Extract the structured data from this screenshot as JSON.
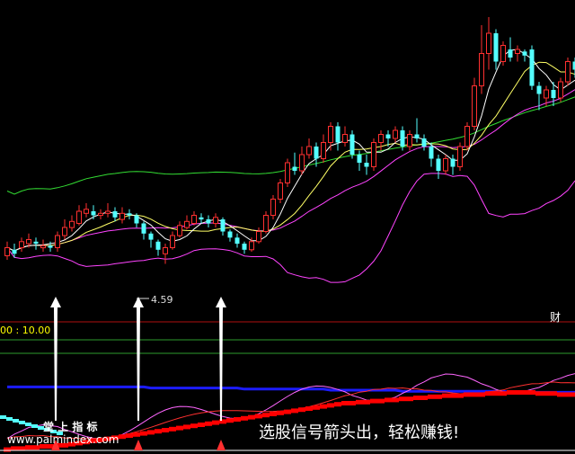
{
  "chart_data": {
    "type": "candlestick",
    "price_panel": {
      "ylim": [
        3.5,
        10.5
      ],
      "candles": [
        [
          4.4,
          4.6,
          4.75,
          4.3
        ],
        [
          4.55,
          4.45,
          4.7,
          4.35
        ],
        [
          4.6,
          4.75,
          4.85,
          4.5
        ],
        [
          4.7,
          4.8,
          4.95,
          4.6
        ],
        [
          4.75,
          4.7,
          4.85,
          4.55
        ],
        [
          4.6,
          4.65,
          4.8,
          4.5
        ],
        [
          4.65,
          4.6,
          4.75,
          4.5
        ],
        [
          4.6,
          4.9,
          5.0,
          4.5
        ],
        [
          4.9,
          5.1,
          5.3,
          4.8
        ],
        [
          5.1,
          5.25,
          5.4,
          5.0
        ],
        [
          5.2,
          5.5,
          5.65,
          5.15
        ],
        [
          5.45,
          5.55,
          5.7,
          5.35
        ],
        [
          5.5,
          5.4,
          5.65,
          5.3
        ],
        [
          5.4,
          5.45,
          5.55,
          5.3
        ],
        [
          5.45,
          5.5,
          5.7,
          5.35
        ],
        [
          5.5,
          5.35,
          5.6,
          5.25
        ],
        [
          5.3,
          5.45,
          5.6,
          5.2
        ],
        [
          5.45,
          5.4,
          5.55,
          5.3
        ],
        [
          5.4,
          5.2,
          5.45,
          5.1
        ],
        [
          5.2,
          4.95,
          5.25,
          4.8
        ],
        [
          4.95,
          4.8,
          5.0,
          4.6
        ],
        [
          4.75,
          4.55,
          4.8,
          4.4
        ],
        [
          4.45,
          4.6,
          4.7,
          4.2
        ],
        [
          4.6,
          4.9,
          5.0,
          4.55
        ],
        [
          4.9,
          5.15,
          5.25,
          4.85
        ],
        [
          5.1,
          5.25,
          5.4,
          5.05
        ],
        [
          5.2,
          5.4,
          5.5,
          5.15
        ],
        [
          5.35,
          5.3,
          5.45,
          5.2
        ],
        [
          5.3,
          5.2,
          5.4,
          5.1
        ],
        [
          5.2,
          5.35,
          5.45,
          5.1
        ],
        [
          5.3,
          5.0,
          5.35,
          4.9
        ],
        [
          5.0,
          4.85,
          5.05,
          4.75
        ],
        [
          4.85,
          4.7,
          4.95,
          4.6
        ],
        [
          4.7,
          4.55,
          4.75,
          4.45
        ],
        [
          4.55,
          4.75,
          4.85,
          4.5
        ],
        [
          4.75,
          5.0,
          5.1,
          4.7
        ],
        [
          5.0,
          5.4,
          5.5,
          4.95
        ],
        [
          5.4,
          5.8,
          5.9,
          5.3
        ],
        [
          5.8,
          6.2,
          6.3,
          5.7
        ],
        [
          6.2,
          6.7,
          6.8,
          6.1
        ],
        [
          6.6,
          6.5,
          6.95,
          6.4
        ],
        [
          6.5,
          6.9,
          7.1,
          6.4
        ],
        [
          6.9,
          7.1,
          7.3,
          6.8
        ],
        [
          7.1,
          6.8,
          7.2,
          6.6
        ],
        [
          6.8,
          7.2,
          7.4,
          6.7
        ],
        [
          7.2,
          7.6,
          7.7,
          7.0
        ],
        [
          7.6,
          7.2,
          7.7,
          7.0
        ],
        [
          7.2,
          7.4,
          7.6,
          7.1
        ],
        [
          7.4,
          6.9,
          7.5,
          6.8
        ],
        [
          6.9,
          6.7,
          7.0,
          6.5
        ],
        [
          6.7,
          6.6,
          6.9,
          6.4
        ],
        [
          6.6,
          7.2,
          7.3,
          6.5
        ],
        [
          7.2,
          7.4,
          7.5,
          7.0
        ],
        [
          7.4,
          7.3,
          7.5,
          7.1
        ],
        [
          7.3,
          7.5,
          7.6,
          7.2
        ],
        [
          7.5,
          7.1,
          7.6,
          7.0
        ],
        [
          7.1,
          7.4,
          7.5,
          7.0
        ],
        [
          7.4,
          7.3,
          7.8,
          7.2
        ],
        [
          7.3,
          7.1,
          7.4,
          7.0
        ],
        [
          7.1,
          6.8,
          7.2,
          6.6
        ],
        [
          6.8,
          6.5,
          6.9,
          6.3
        ],
        [
          6.5,
          6.8,
          6.9,
          6.4
        ],
        [
          6.8,
          6.6,
          6.9,
          6.4
        ],
        [
          6.6,
          7.1,
          7.2,
          6.5
        ],
        [
          7.1,
          7.6,
          7.7,
          7.0
        ],
        [
          7.6,
          8.6,
          8.8,
          7.5
        ],
        [
          8.6,
          9.4,
          10.1,
          8.4
        ],
        [
          9.4,
          9.9,
          10.3,
          9.0
        ],
        [
          9.9,
          9.2,
          10.0,
          9.0
        ],
        [
          9.2,
          9.6,
          9.7,
          9.1
        ],
        [
          9.5,
          9.3,
          9.8,
          9.2
        ],
        [
          9.4,
          9.5,
          9.6,
          9.2
        ],
        [
          9.45,
          9.35,
          9.5,
          9.2
        ],
        [
          9.5,
          8.6,
          9.6,
          8.5
        ],
        [
          8.6,
          8.4,
          8.7,
          8.0
        ],
        [
          8.3,
          8.5,
          8.6,
          8.1
        ],
        [
          8.5,
          8.3,
          8.7,
          8.1
        ],
        [
          8.3,
          8.7,
          8.8,
          8.2
        ],
        [
          8.7,
          9.2,
          9.3,
          8.6
        ],
        [
          9.2,
          9.0,
          9.3,
          8.8
        ]
      ],
      "annotation": "4.59"
    },
    "indicator_panel": {
      "readout": "00 : 10.00",
      "ylim": [
        0,
        100
      ],
      "red_signal": [
        2,
        3,
        3,
        4,
        4,
        5,
        5,
        6,
        6,
        7,
        8,
        9,
        10,
        11,
        12,
        13,
        14,
        15,
        16,
        17,
        18,
        19,
        20,
        21,
        22,
        23,
        24,
        25,
        26,
        27,
        28,
        29,
        30,
        31,
        32,
        33,
        34,
        35,
        36,
        37,
        38,
        39,
        40,
        41,
        42,
        43,
        44,
        45,
        45,
        46,
        46,
        47,
        47,
        48,
        48,
        49,
        49,
        50,
        50,
        51,
        51,
        52,
        52,
        52,
        53,
        53,
        53,
        54,
        54,
        54,
        55,
        55,
        55,
        55,
        54,
        54,
        54,
        53,
        53,
        53
      ],
      "blue_line": [
        58,
        58,
        58,
        58,
        58,
        58,
        58,
        58,
        58,
        58,
        58,
        58,
        58,
        58,
        58,
        58,
        58,
        58,
        58,
        58,
        57,
        57,
        57,
        57,
        57,
        57,
        57,
        57,
        57,
        57,
        57,
        57,
        57,
        56,
        56,
        56,
        56,
        56,
        56,
        56,
        56,
        56,
        56,
        56,
        56,
        55,
        55,
        55,
        55,
        55,
        55,
        55,
        55,
        55,
        55,
        54,
        54,
        54,
        54,
        54,
        54,
        54,
        54,
        54,
        54,
        54,
        54,
        54,
        54,
        54,
        53,
        53,
        53,
        53,
        53,
        53,
        53,
        53,
        53,
        53
      ]
    },
    "signal_positions": [
      8,
      19,
      30
    ]
  },
  "labels": {
    "panel_tag": "财",
    "watermark_title": "堂 上 指 标",
    "watermark_url": "www.palmindex.com",
    "caption": "选股信号箭头出，轻松赚钱!"
  },
  "colors": {
    "up": "#ff3030",
    "down": "#54ffff",
    "ma_short": "#ffffff",
    "ma_mid": "#ffff66",
    "ma_long": "#ff44ff",
    "ma_green": "#33dd33",
    "blue": "#1c1cff",
    "red_signal": "#ff0000",
    "pink": "#ff66ff",
    "panel_line": "#b01010"
  }
}
